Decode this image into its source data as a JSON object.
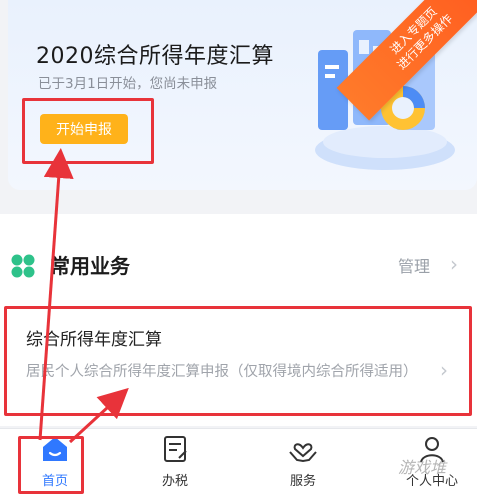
{
  "banner": {
    "title": "2020综合所得年度汇算",
    "subtitle": "已于3月1日开始，您尚未申报",
    "start_button": "开始申报",
    "ribbon_line1": "进入专题页",
    "ribbon_line2": "进行更多操作"
  },
  "section": {
    "title": "常用业务",
    "manage_label": "管理",
    "icon": "clover-icon"
  },
  "item": {
    "title": "综合所得年度汇算",
    "description": "居民个人综合所得年度汇算申报（仅取得境内综合所得适用）"
  },
  "tabs": [
    {
      "label": "首页",
      "icon": "home-icon",
      "active": true
    },
    {
      "label": "办税",
      "icon": "document-edit-icon",
      "active": false
    },
    {
      "label": "服务",
      "icon": "hands-heart-icon",
      "active": false
    },
    {
      "label": "个人中心",
      "icon": "person-icon",
      "active": false
    }
  ],
  "watermark": "游戏堆",
  "colors": {
    "accent_orange": "#ffb21a",
    "ribbon": "#ff5b1f",
    "tab_active": "#2f78ff",
    "clover_green": "#2ec28a",
    "annotation_red": "#e8333a"
  }
}
